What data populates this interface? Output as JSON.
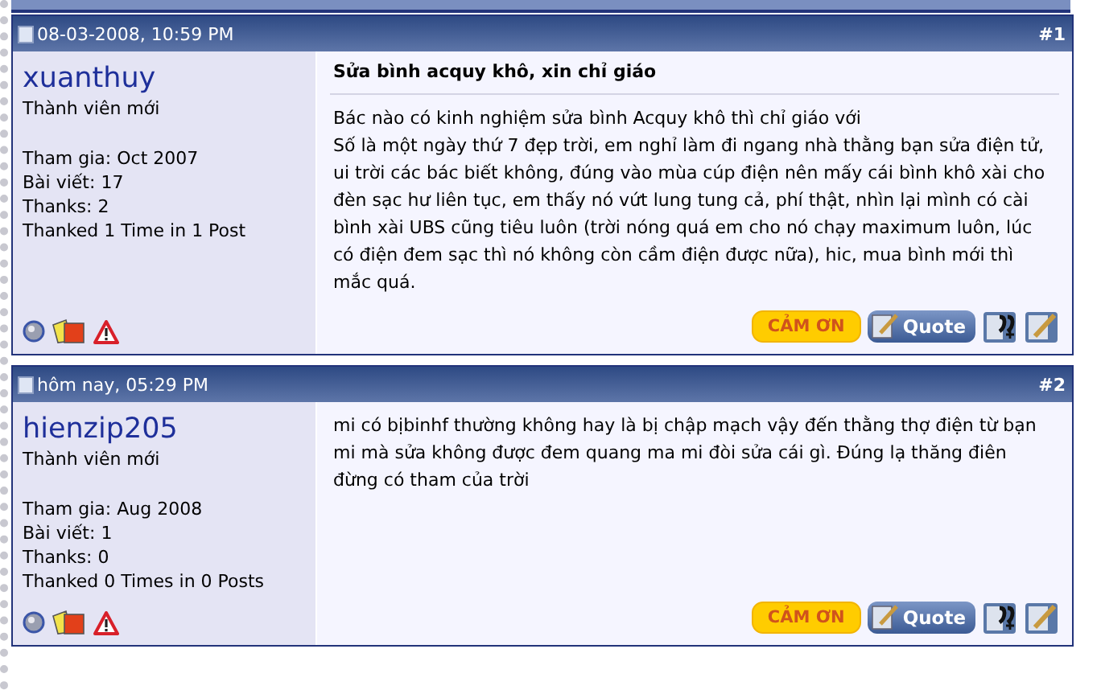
{
  "posts": [
    {
      "date": "08-03-2008, 10:59 PM",
      "number": "#1",
      "username": "xuanthuy",
      "rank": "Thành viên mới",
      "stats": [
        "Tham gia: Oct 2007",
        "Bài viết: 17",
        "Thanks: 2",
        "Thanked 1 Time in 1 Post"
      ],
      "title": "Sửa bình acquy khô, xin chỉ giáo",
      "paragraphs": [
        "Bác nào có kinh nghiệm sửa bình Acquy khô thì chỉ giáo với",
        "Số là một ngày thứ 7 đẹp trời, em nghỉ làm đi ngang nhà thằng bạn sửa điện tử, ui trời các bác biết không, đúng vào mùa cúp điện nên mấy cái bình khô xài cho đèn sạc hư liên tục, em thấy nó vứt lung tung cả, phí thật, nhìn lại mình có cài bình xài UBS cũng tiêu luôn (trời nóng quá em cho nó chạy maximum luôn, lúc có điện đem sạc thì nó không còn cầm điện được nữa), hic, mua bình mới thì mắc quá."
      ],
      "thanks_label": "CẢM ƠN",
      "quote_label": "Quote"
    },
    {
      "date": "hôm nay, 05:29 PM",
      "number": "#2",
      "username": "hienzip205",
      "rank": "Thành viên mới",
      "stats": [
        "Tham gia: Aug 2008",
        "Bài viết: 1",
        "Thanks: 0",
        "Thanked 0 Times in 0 Posts"
      ],
      "paragraphs": [
        "mi có bịbinhf thường không hay là bị chập mạch vậy đến thằng thợ điện từ bạn mi mà sửa không được đem quang ma mi đòi sửa cái gì. Đúng lạ thăng điên đừng có tham của trời"
      ],
      "thanks_label": "CẢM ƠN",
      "quote_label": "Quote"
    }
  ]
}
